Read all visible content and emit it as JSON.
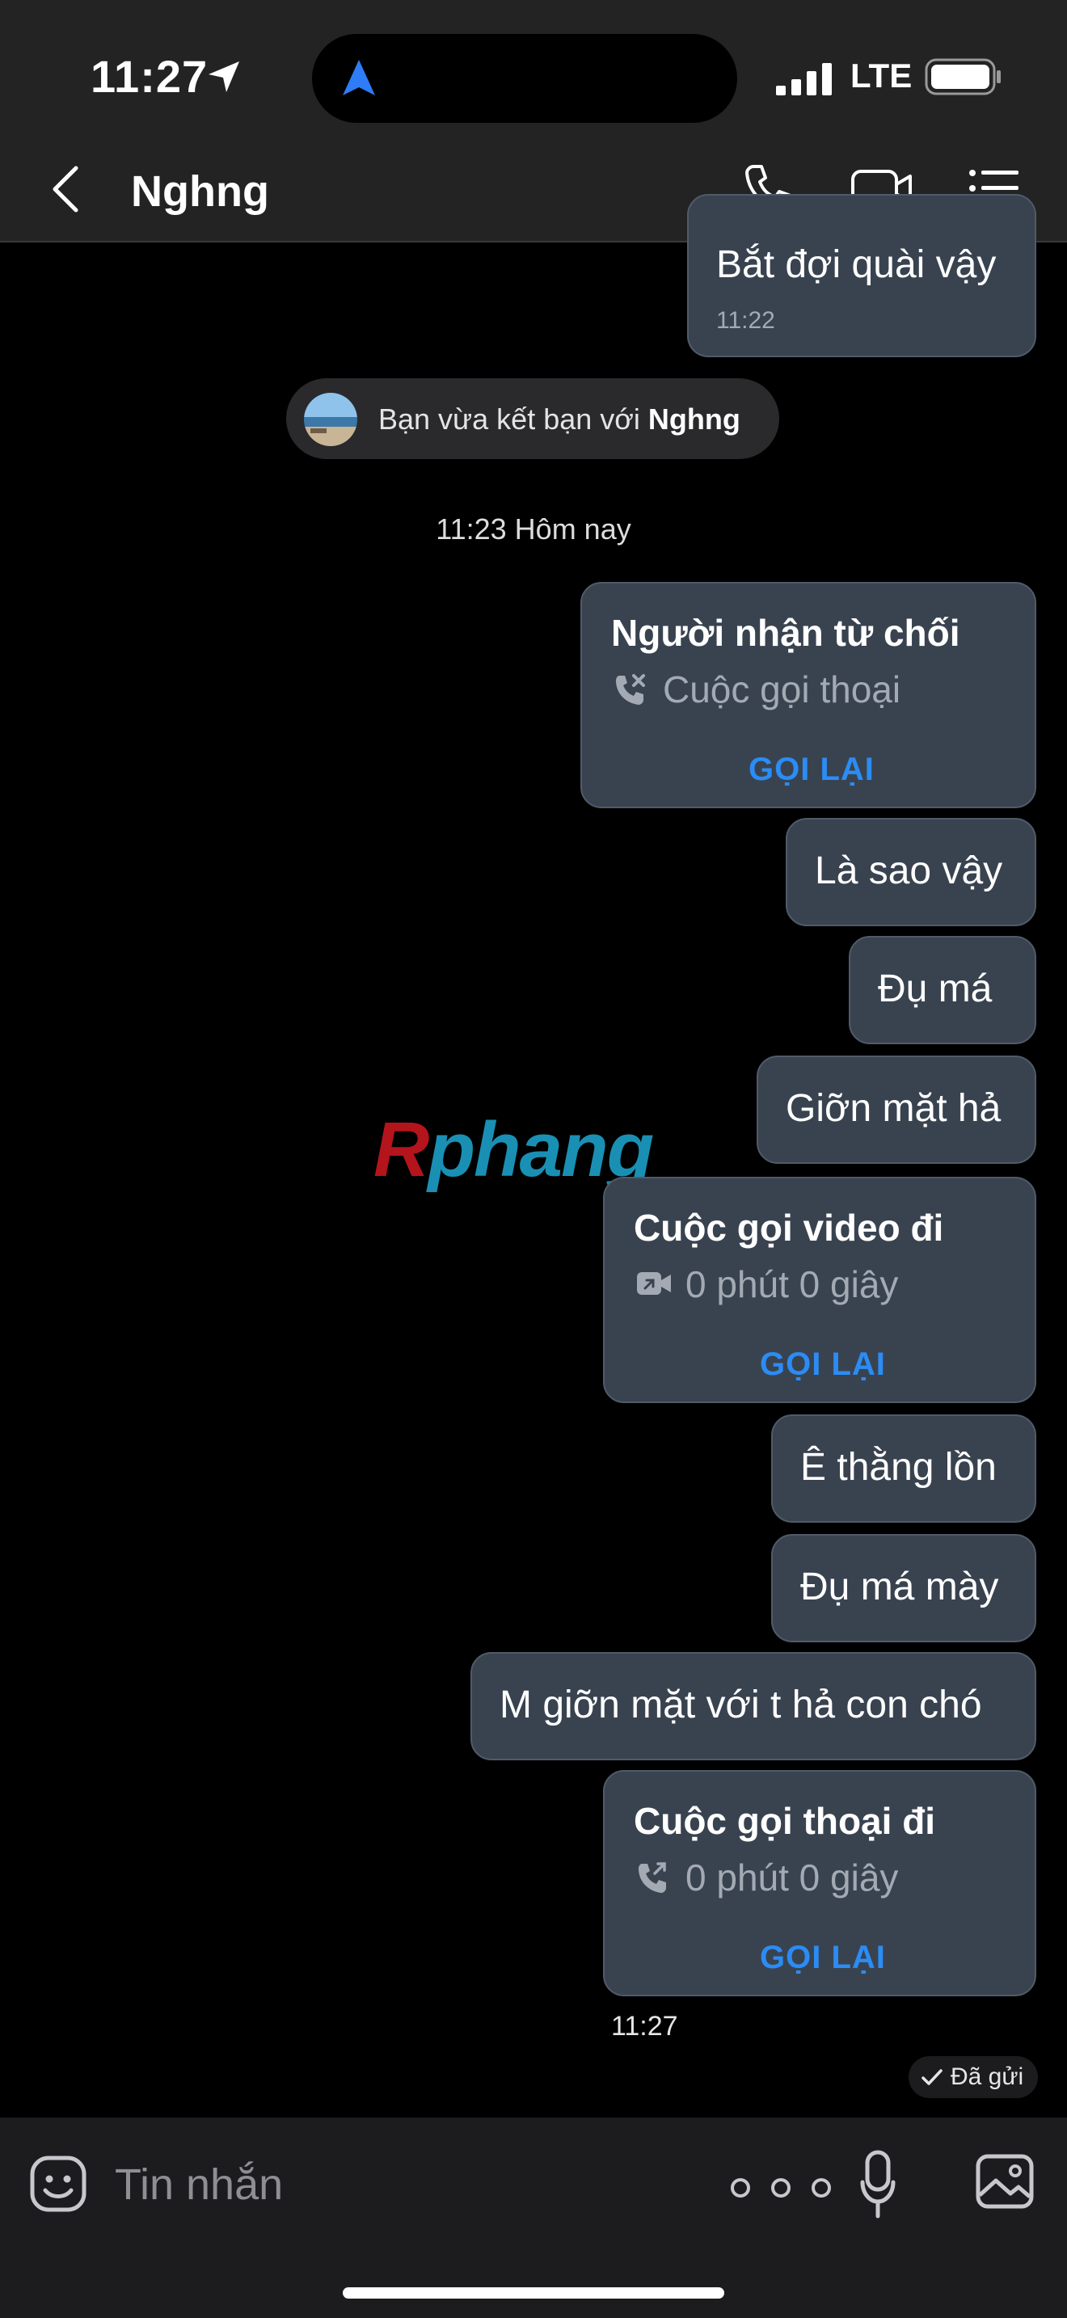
{
  "status_bar": {
    "time": "11:27",
    "network": "LTE"
  },
  "header": {
    "contact_name": "Nghng"
  },
  "messages": {
    "prev_bubble": {
      "text": "Bắt đợi quài vậy",
      "time": "11:22"
    },
    "friend_notice": {
      "text_prefix": "Bạn vừa kết bạn với ",
      "name": "Nghng"
    },
    "date_separator": "11:23 Hôm nay",
    "call1": {
      "title": "Người nhận từ chối",
      "subtitle": "Cuộc gọi thoại",
      "action": "GỌI LẠI"
    },
    "text1": "Là sao vậy",
    "text2": "Đụ má",
    "text3": "Giỡn mặt hả",
    "call2": {
      "title": "Cuộc gọi video đi",
      "subtitle": "0 phút 0 giây",
      "action": "GỌI LẠI"
    },
    "text4": "Ê thằng lồn",
    "text5": "Đụ má mày",
    "text6": "M giỡn mặt với t hả con chó",
    "call3": {
      "title": "Cuộc gọi thoại đi",
      "subtitle": "0 phút 0 giây",
      "action": "GỌI LẠI"
    },
    "last_time": "11:27",
    "sent_status": "Đã gửi"
  },
  "watermark": {
    "part1": "R",
    "part2": "phang"
  },
  "composer": {
    "placeholder": "Tin nhắn"
  },
  "colors": {
    "accent": "#2b8cf5",
    "bubble": "#394350",
    "header_bg": "#232323"
  }
}
